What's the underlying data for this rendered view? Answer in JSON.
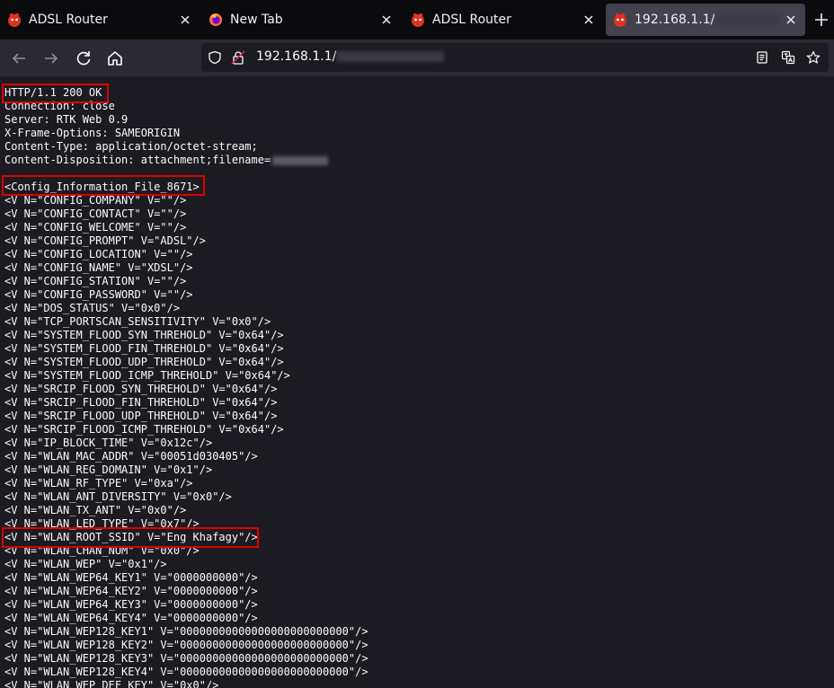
{
  "tabs": [
    {
      "title": "ADSL Router",
      "icon": "router-favicon-icon"
    },
    {
      "title": "New Tab",
      "icon": "firefox-icon"
    },
    {
      "title": "ADSL Router",
      "icon": "router-favicon-icon"
    },
    {
      "title": "192.168.1.1/",
      "icon": "router-favicon-icon"
    }
  ],
  "url": {
    "host": "192.168.1.1/"
  },
  "headers": [
    "HTTP/1.1 200 OK",
    "Connection: close",
    "Server: RTK Web 0.9",
    "X-Frame-Options: SAMEORIGIN",
    "Content-Type: application/octet-stream;",
    "Content-Disposition: attachment;filename="
  ],
  "config_lines": [
    "<Config_Information_File_8671>",
    "<V N=\"CONFIG_COMPANY\" V=\"\"/>",
    "<V N=\"CONFIG_CONTACT\" V=\"\"/>",
    "<V N=\"CONFIG_WELCOME\" V=\"\"/>",
    "<V N=\"CONFIG_PROMPT\" V=\"ADSL\"/>",
    "<V N=\"CONFIG_LOCATION\" V=\"\"/>",
    "<V N=\"CONFIG_NAME\" V=\"XDSL\"/>",
    "<V N=\"CONFIG_STATION\" V=\"\"/>",
    "<V N=\"CONFIG_PASSWORD\" V=\"\"/>",
    "<V N=\"DOS_STATUS\" V=\"0x0\"/>",
    "<V N=\"TCP_PORTSCAN_SENSITIVITY\" V=\"0x0\"/>",
    "<V N=\"SYSTEM_FLOOD_SYN_THREHOLD\" V=\"0x64\"/>",
    "<V N=\"SYSTEM_FLOOD_FIN_THREHOLD\" V=\"0x64\"/>",
    "<V N=\"SYSTEM_FLOOD_UDP_THREHOLD\" V=\"0x64\"/>",
    "<V N=\"SYSTEM_FLOOD_ICMP_THREHOLD\" V=\"0x64\"/>",
    "<V N=\"SRCIP_FLOOD_SYN_THREHOLD\" V=\"0x64\"/>",
    "<V N=\"SRCIP_FLOOD_FIN_THREHOLD\" V=\"0x64\"/>",
    "<V N=\"SRCIP_FLOOD_UDP_THREHOLD\" V=\"0x64\"/>",
    "<V N=\"SRCIP_FLOOD_ICMP_THREHOLD\" V=\"0x64\"/>",
    "<V N=\"IP_BLOCK_TIME\" V=\"0x12c\"/>",
    "<V N=\"WLAN_MAC_ADDR\" V=\"00051d030405\"/>",
    "<V N=\"WLAN_REG_DOMAIN\" V=\"0x1\"/>",
    "<V N=\"WLAN_RF_TYPE\" V=\"0xa\"/>",
    "<V N=\"WLAN_ANT_DIVERSITY\" V=\"0x0\"/>",
    "<V N=\"WLAN_TX_ANT\" V=\"0x0\"/>",
    "<V N=\"WLAN_LED_TYPE\" V=\"0x7\"/>",
    "<V N=\"WLAN_ROOT_SSID\" V=\"Eng Khafagy\"/>",
    "<V N=\"WLAN_CHAN_NUM\" V=\"0x0\"/>",
    "<V N=\"WLAN_WEP\" V=\"0x1\"/>",
    "<V N=\"WLAN_WEP64_KEY1\" V=\"0000000000\"/>",
    "<V N=\"WLAN_WEP64_KEY2\" V=\"0000000000\"/>",
    "<V N=\"WLAN_WEP64_KEY3\" V=\"0000000000\"/>",
    "<V N=\"WLAN_WEP64_KEY4\" V=\"0000000000\"/>",
    "<V N=\"WLAN_WEP128_KEY1\" V=\"00000000000000000000000000\"/>",
    "<V N=\"WLAN_WEP128_KEY2\" V=\"00000000000000000000000000\"/>",
    "<V N=\"WLAN_WEP128_KEY3\" V=\"00000000000000000000000000\"/>",
    "<V N=\"WLAN_WEP128_KEY4\" V=\"00000000000000000000000000\"/>",
    "<V N=\"WLAN_WEP_DEF_KEY\" V=\"0x0\"/>"
  ],
  "colors": {
    "highlight": "#e00000",
    "tab_active": "#42414d",
    "toolbar": "#2b2a33",
    "background": "#1c1b22"
  }
}
